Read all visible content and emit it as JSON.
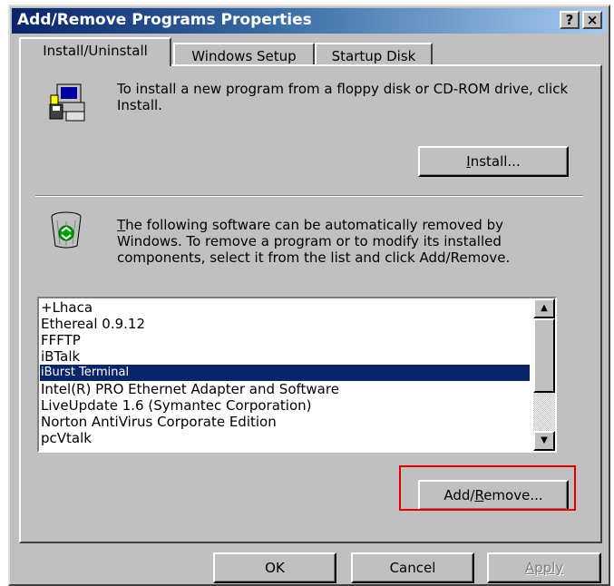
{
  "window": {
    "title": "Add/Remove Programs Properties",
    "help_button": "?",
    "close_button": "×"
  },
  "tabs": [
    {
      "label": "Install/Uninstall",
      "active": true
    },
    {
      "label": "Windows Setup",
      "active": false
    },
    {
      "label": "Startup Disk",
      "active": false
    }
  ],
  "install_section": {
    "icon": "floppy-computer-icon",
    "text": "To install a new program from a floppy disk or CD-ROM drive, click Install.",
    "button": {
      "mnemonic": "I",
      "rest": "nstall..."
    }
  },
  "uninstall_section": {
    "icon": "recycle-bin-icon",
    "text_mnemonic": "T",
    "text_rest": "he following software can be automatically removed by Windows. To remove a program or to modify its installed components, select it from the list and click Add/Remove."
  },
  "programs": [
    "+Lhaca",
    "Ethereal 0.9.12",
    "FFFTP",
    "iBTalk",
    "iBurst Terminal",
    "Intel(R) PRO Ethernet Adapter and Software",
    "LiveUpdate 1.6 (Symantec Corporation)",
    "Norton AntiVirus Corporate Edition",
    "pcVtalk"
  ],
  "selected_program": "iBurst Terminal",
  "add_remove_button": {
    "before": "Add/",
    "mnemonic": "R",
    "after": "emove..."
  },
  "footer": {
    "ok": "OK",
    "cancel": "Cancel",
    "apply": "Apply"
  },
  "colors": {
    "title_bar": "#0a246a",
    "selection": "#0a246a",
    "highlight_box": "#e00000"
  }
}
